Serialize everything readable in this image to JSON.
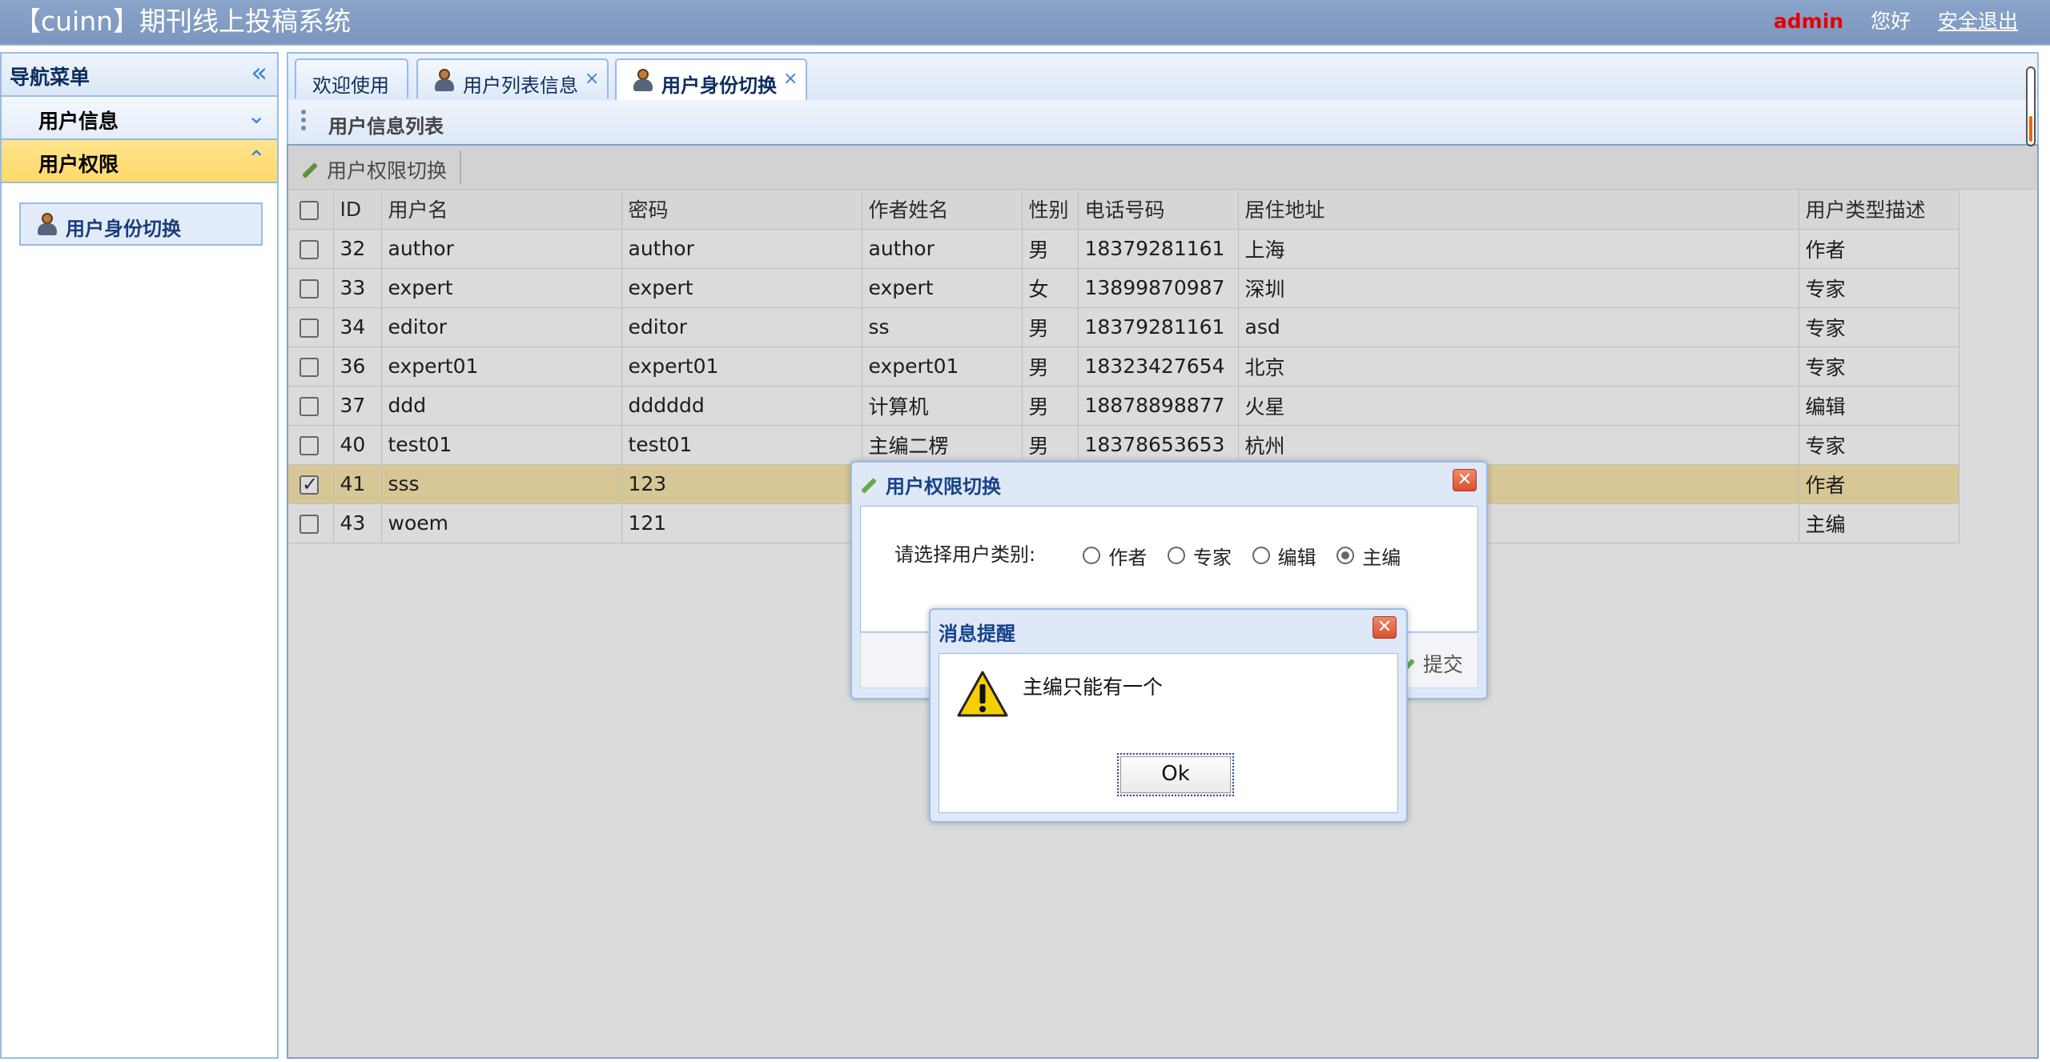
{
  "header": {
    "app_title": "【cuinn】期刊线上投稿系统",
    "user": "admin",
    "greeting": "您好",
    "logout": "安全退出"
  },
  "sidebar": {
    "title": "导航菜单",
    "groups": [
      {
        "label": "用户信息",
        "icon": "chevron-down-double-icon"
      },
      {
        "label": "用户权限",
        "icon": "chevron-up-double-icon",
        "active": true
      }
    ],
    "item": {
      "label": "用户身份切换",
      "icon": "user-icon"
    }
  },
  "tabs": [
    {
      "label": "欢迎使用"
    },
    {
      "label": "用户列表信息",
      "close": "×"
    },
    {
      "label": "用户身份切换",
      "close": "×",
      "active": true
    }
  ],
  "panel": {
    "title": "用户信息列表",
    "toolbar_button": "用户权限切换"
  },
  "grid": {
    "columns": [
      "ID",
      "用户名",
      "密码",
      "作者姓名",
      "性别",
      "电话号码",
      "居住地址",
      "用户类型描述"
    ],
    "rows": [
      {
        "id": "32",
        "username": "author",
        "password": "author",
        "name": "author",
        "gender": "男",
        "phone": "18379281161",
        "address": "上海",
        "type": "作者"
      },
      {
        "id": "33",
        "username": "expert",
        "password": "expert",
        "name": "expert",
        "gender": "女",
        "phone": "13899870987",
        "address": "深圳",
        "type": "专家"
      },
      {
        "id": "34",
        "username": "editor",
        "password": "editor",
        "name": "ss",
        "gender": "男",
        "phone": "18379281161",
        "address": "asd",
        "type": "专家"
      },
      {
        "id": "36",
        "username": "expert01",
        "password": "expert01",
        "name": "expert01",
        "gender": "男",
        "phone": "18323427654",
        "address": "北京",
        "type": "专家"
      },
      {
        "id": "37",
        "username": "ddd",
        "password": "dddddd",
        "name": "计算机",
        "gender": "男",
        "phone": "18878898877",
        "address": "火星",
        "type": "编辑"
      },
      {
        "id": "40",
        "username": "test01",
        "password": "test01",
        "name": "主编二楞",
        "gender": "男",
        "phone": "18378653653",
        "address": "杭州",
        "type": "专家"
      },
      {
        "id": "41",
        "username": "sss",
        "password": "123",
        "name": "",
        "gender": "",
        "phone": "",
        "address": "",
        "type": "作者",
        "selected": true
      },
      {
        "id": "43",
        "username": "woem",
        "password": "121",
        "name": "",
        "gender": "",
        "phone": "",
        "address": "",
        "type": "主编"
      }
    ]
  },
  "role_dialog": {
    "title": "用户权限切换",
    "prompt": "请选择用户类别:",
    "options": [
      "作者",
      "专家",
      "编辑",
      "主编"
    ],
    "selected": "主编",
    "submit": "提交"
  },
  "message_dialog": {
    "title": "消息提醒",
    "message": "主编只能有一个",
    "ok": "Ok",
    "icon": "warning-icon"
  },
  "colors": {
    "header_bg": "#7c96c0",
    "admin": "#e60000",
    "active_group": "#ffd96a",
    "border": "#99bbe8",
    "selected_row": "#fbe8b0"
  }
}
